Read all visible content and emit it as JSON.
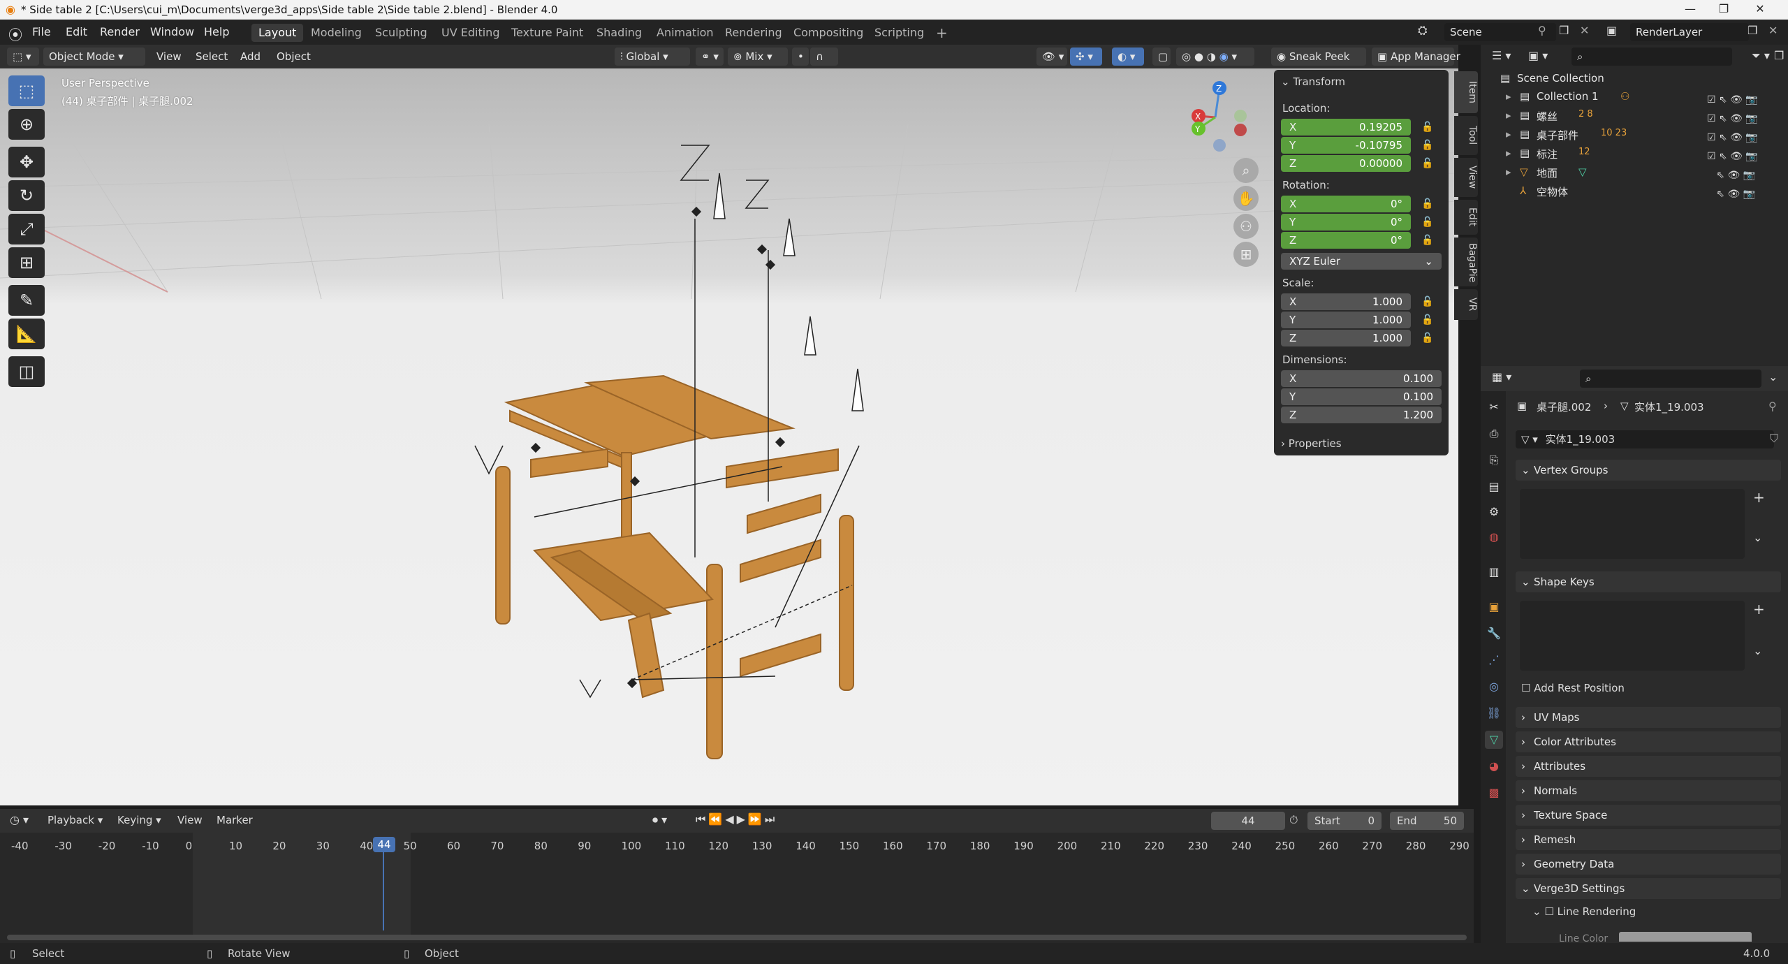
{
  "titlebar": {
    "title": "* Side table 2 [C:\\Users\\cui_m\\Documents\\verge3d_apps\\Side table 2\\Side table 2.blend] - Blender 4.0"
  },
  "menu": [
    "File",
    "Edit",
    "Render",
    "Window",
    "Help"
  ],
  "workspaces": [
    "Layout",
    "Modeling",
    "Sculpting",
    "UV Editing",
    "Texture Paint",
    "Shading",
    "Animation",
    "Rendering",
    "Compositing",
    "Scripting"
  ],
  "scene": {
    "name": "Scene",
    "render_layer": "RenderLayer"
  },
  "viewport_header": {
    "mode": "Object Mode",
    "menus": [
      "View",
      "Select",
      "Add",
      "Object"
    ],
    "orientation": "Global",
    "snap_mix": "Mix",
    "sneak_peek": "Sneak Peek",
    "app_manager": "App Manager"
  },
  "viewport": {
    "title": "User Perspective",
    "subtitle": "(44) 桌子部件 | 桌子腿.002"
  },
  "gizmo": {
    "x": "X",
    "y": "Y",
    "z": "Z"
  },
  "transform": {
    "header": "Transform",
    "location_label": "Location:",
    "location": [
      {
        "axis": "X",
        "value": "0.19205"
      },
      {
        "axis": "Y",
        "value": "-0.10795"
      },
      {
        "axis": "Z",
        "value": "0.00000"
      }
    ],
    "rotation_label": "Rotation:",
    "rotation": [
      {
        "axis": "X",
        "value": "0°"
      },
      {
        "axis": "Y",
        "value": "0°"
      },
      {
        "axis": "Z",
        "value": "0°"
      }
    ],
    "rotation_mode": "XYZ Euler",
    "scale_label": "Scale:",
    "scale": [
      {
        "axis": "X",
        "value": "1.000"
      },
      {
        "axis": "Y",
        "value": "1.000"
      },
      {
        "axis": "Z",
        "value": "1.000"
      }
    ],
    "dimensions_label": "Dimensions:",
    "dimensions": [
      {
        "axis": "X",
        "value": "0.100"
      },
      {
        "axis": "Y",
        "value": "0.100"
      },
      {
        "axis": "Z",
        "value": "1.200"
      }
    ],
    "properties": "Properties"
  },
  "npanel_tabs": [
    "Item",
    "Tool",
    "View",
    "Edit",
    "BagaPie",
    "VR"
  ],
  "outliner": {
    "root": "Scene Collection",
    "rows": [
      {
        "name": "Collection 1",
        "badge": ""
      },
      {
        "name": "螺丝",
        "badge": "2  8"
      },
      {
        "name": "桌子部件",
        "badge": "10  23"
      },
      {
        "name": "标注",
        "badge": "12"
      },
      {
        "name": "地面",
        "badge": ""
      },
      {
        "name": "空物体",
        "badge": ""
      }
    ]
  },
  "properties": {
    "breadcrumb_object": "桌子腿.002",
    "breadcrumb_mesh": "实体1_19.003",
    "mesh_name": "实体1_19.003",
    "vertex_groups": "Vertex Groups",
    "shape_keys": "Shape Keys",
    "add_rest_position": "Add Rest Position",
    "sections": [
      "UV Maps",
      "Color Attributes",
      "Attributes",
      "Normals",
      "Texture Space",
      "Remesh",
      "Geometry Data"
    ],
    "verge3d": "Verge3D Settings",
    "line_rendering": "Line Rendering",
    "line_color": "Line Color"
  },
  "timeline": {
    "menus": [
      "Playback",
      "Keying",
      "View",
      "Marker"
    ],
    "current_frame": "44",
    "start_label": "Start",
    "start": "0",
    "end_label": "End",
    "end": "50",
    "ticks": [
      "-40",
      "-30",
      "-20",
      "-10",
      "0",
      "10",
      "20",
      "30",
      "40",
      "50",
      "60",
      "70",
      "80",
      "90",
      "100",
      "110",
      "120",
      "130",
      "140",
      "150",
      "160",
      "170",
      "180",
      "190",
      "200",
      "210",
      "220",
      "230",
      "240",
      "250",
      "260",
      "270",
      "280",
      "290"
    ]
  },
  "statusbar": {
    "select": "Select",
    "rotate": "Rotate View",
    "object": "Object",
    "version": "4.0.0"
  },
  "colors": {
    "accent": "#4772b3",
    "green_field": "#5a9e3d",
    "wood": "#c98a3e"
  }
}
